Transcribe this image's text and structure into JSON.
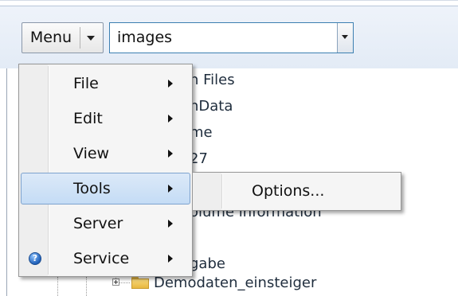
{
  "toolbar": {
    "menu_label": "Menu",
    "path_value": "images"
  },
  "tree": {
    "visible_fragments": [
      "n Files",
      "nData",
      "me",
      "27",
      "olume information",
      "gabe",
      "Demodaten_einsteiger"
    ]
  },
  "context_menu": {
    "items": [
      {
        "label": "File",
        "has_submenu": true
      },
      {
        "label": "Edit",
        "has_submenu": true
      },
      {
        "label": "View",
        "has_submenu": true
      },
      {
        "label": "Tools",
        "has_submenu": true,
        "highlighted": true
      },
      {
        "label": "Server",
        "has_submenu": true
      },
      {
        "label": "Service",
        "has_submenu": true,
        "icon": "help-icon"
      }
    ]
  },
  "submenu": {
    "parent": "Tools",
    "items": [
      {
        "label": "Options..."
      }
    ]
  },
  "colors": {
    "highlight_bg": "#c4dcf5",
    "highlight_border": "#7da2ce",
    "combo_border": "#3c7fb1",
    "folder": "#e8b840"
  }
}
